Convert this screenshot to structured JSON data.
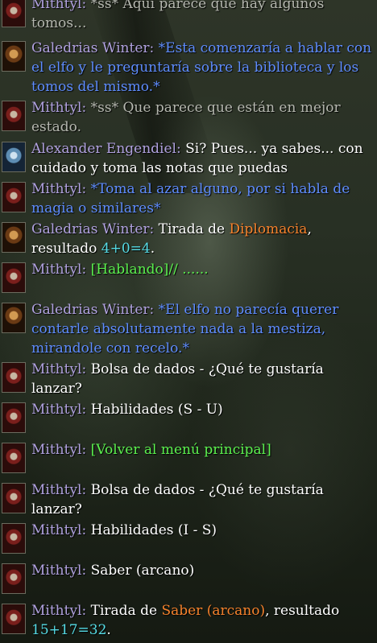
{
  "chat_log": {
    "rows": [
      {
        "speaker": "Mithtyl",
        "sep": ": ",
        "parts": [
          {
            "text": "*ss* Aquí parece que hay algunos tomos...",
            "style": "whisper"
          }
        ]
      },
      {
        "speaker": "Galedrias Winter",
        "sep": ": ",
        "parts": [
          {
            "text": "*Esta comenzaría a hablar con el elfo y le preguntaría sobre la biblioteca y los tomos del mismo.*",
            "style": "emote"
          }
        ]
      },
      {
        "speaker": "Mithtyl",
        "sep": ": ",
        "parts": [
          {
            "text": "*ss* Que parece que están en mejor estado.",
            "style": "whisper"
          }
        ]
      },
      {
        "speaker": "Alexander Engendiel",
        "sep": ": ",
        "parts": [
          {
            "text": "Si? Pues... ya sabes... con cuidado y toma las notas que puedas",
            "style": "white"
          }
        ]
      },
      {
        "speaker": "Mithtyl",
        "sep": ": ",
        "parts": [
          {
            "text": "*Toma al azar alguno, por si habla de magia o similares*",
            "style": "emote"
          }
        ]
      },
      {
        "speaker": "Galedrias Winter",
        "sep": ": ",
        "parts": [
          {
            "text": "Tirada de ",
            "style": "white"
          },
          {
            "text": "Diplomacia",
            "style": "orange"
          },
          {
            "text": ", resultado ",
            "style": "white"
          },
          {
            "text": "4+0=4",
            "style": "cyan"
          },
          {
            "text": ".",
            "style": "white"
          }
        ]
      },
      {
        "speaker": "Mithtyl",
        "sep": ": ",
        "parts": [
          {
            "text": "[Hablando]// ......",
            "style": "green"
          }
        ]
      },
      {
        "speaker": "Galedrias Winter",
        "sep": ": ",
        "parts": [
          {
            "text": "*El elfo no parecía querer contarle absolutamente nada a la mestiza, mirandole con recelo.*",
            "style": "emote"
          }
        ]
      },
      {
        "speaker": "Mithtyl",
        "sep": ": ",
        "parts": [
          {
            "text": "Bolsa de dados - ¿Qué te gustaría lanzar?",
            "style": "white"
          }
        ]
      },
      {
        "speaker": "Mithtyl",
        "sep": ": ",
        "parts": [
          {
            "text": "Habilidades (S - U)",
            "style": "white"
          }
        ]
      },
      {
        "speaker": "Mithtyl",
        "sep": ": ",
        "parts": [
          {
            "text": "[Volver al menú principal]",
            "style": "green"
          }
        ]
      },
      {
        "speaker": "Mithtyl",
        "sep": ": ",
        "parts": [
          {
            "text": "Bolsa de dados - ¿Qué te gustaría lanzar?",
            "style": "white"
          }
        ]
      },
      {
        "speaker": "Mithtyl",
        "sep": ": ",
        "parts": [
          {
            "text": "Habilidades (I - S)",
            "style": "white"
          }
        ]
      },
      {
        "speaker": "Mithtyl",
        "sep": ": ",
        "parts": [
          {
            "text": "Saber (arcano)",
            "style": "white"
          }
        ]
      },
      {
        "speaker": "Mithtyl",
        "sep": ": ",
        "parts": [
          {
            "text": "Tirada de ",
            "style": "white"
          },
          {
            "text": "Saber (arcano)",
            "style": "orange"
          },
          {
            "text": ", resultado ",
            "style": "white"
          },
          {
            "text": "15+17=32",
            "style": "cyan"
          },
          {
            "text": ".",
            "style": "white"
          }
        ]
      }
    ]
  },
  "portraits": {
    "Mithtyl": "red-hooded-figure",
    "Galedrias Winter": "bearded-warrior",
    "Alexander Engendiel": "blue-armored-knight"
  },
  "colors": {
    "speaker_name": "#b1a2e0",
    "emote": "#5f8dff",
    "whisper": "#b6b8b0",
    "skill": "#f6822c",
    "result": "#56dce6",
    "dialog_option": "#5cf24f",
    "text": "#ffffff"
  }
}
